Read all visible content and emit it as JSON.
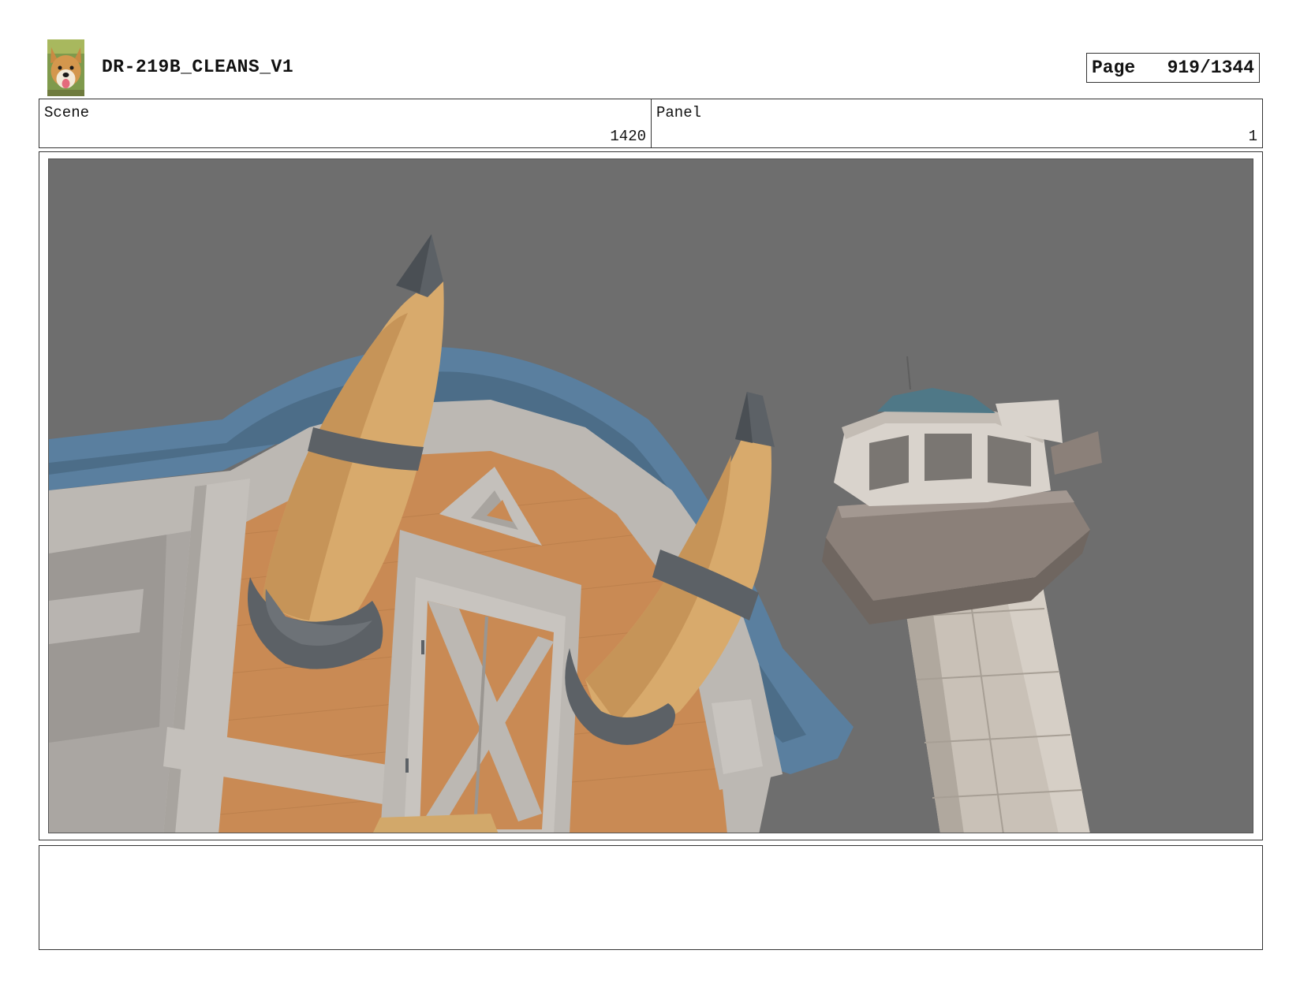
{
  "header": {
    "project_title": "DR-219B_CLEANS_V1",
    "page_label": "Page",
    "page_value": "919/1344"
  },
  "info": {
    "scene_label": "Scene",
    "scene_value": "1420",
    "panel_label": "Panel",
    "panel_value": "1"
  },
  "notes": {
    "text": ""
  },
  "colors": {
    "sky": "#6e6e6e",
    "roof_blue": "#5a7f9f",
    "wood_orange": "#c98a54",
    "trim_white": "#bcb8b3",
    "horn": "#d8aa6c",
    "horn_band": "#5c6166",
    "tower_cap": "#4f7887",
    "tower_deck": "#8b8079",
    "tower_shaft": "#c9c1b7"
  }
}
